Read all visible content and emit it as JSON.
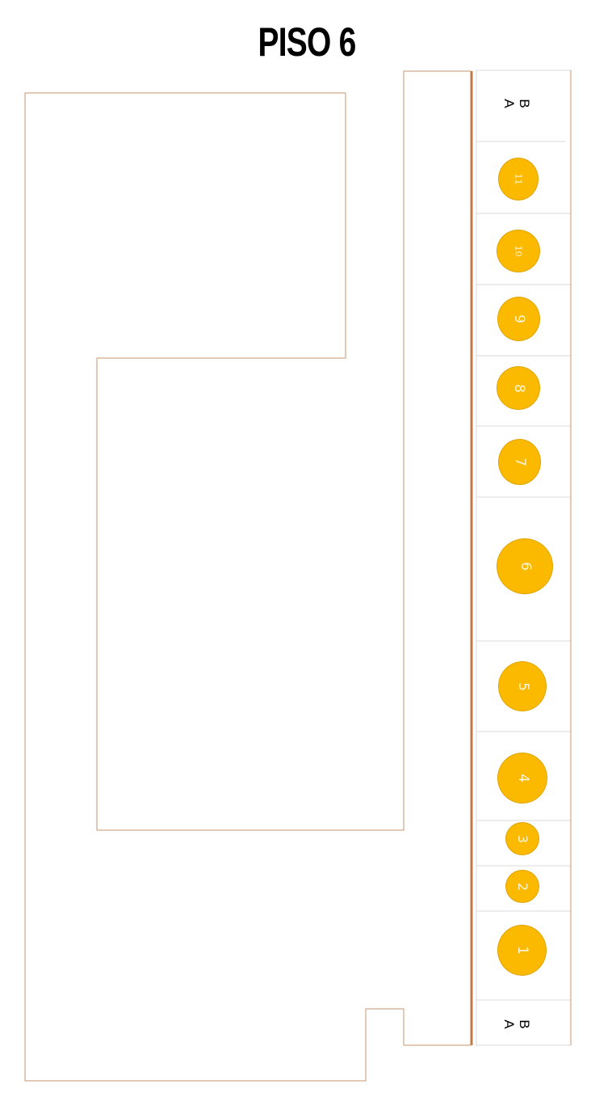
{
  "title": "PISO 6",
  "colors": {
    "outline": "#c8956a",
    "divider": "#c07a45",
    "spot_fill": "#fbba00",
    "spot_text": "#fff5d8"
  },
  "end_labels": {
    "top": {
      "b": "B",
      "a": "A"
    },
    "bottom": {
      "b": "B",
      "a": "A"
    }
  },
  "spots": [
    "11",
    "10",
    "9",
    "8",
    "7",
    "6",
    "5",
    "4",
    "3",
    "2",
    "1"
  ]
}
